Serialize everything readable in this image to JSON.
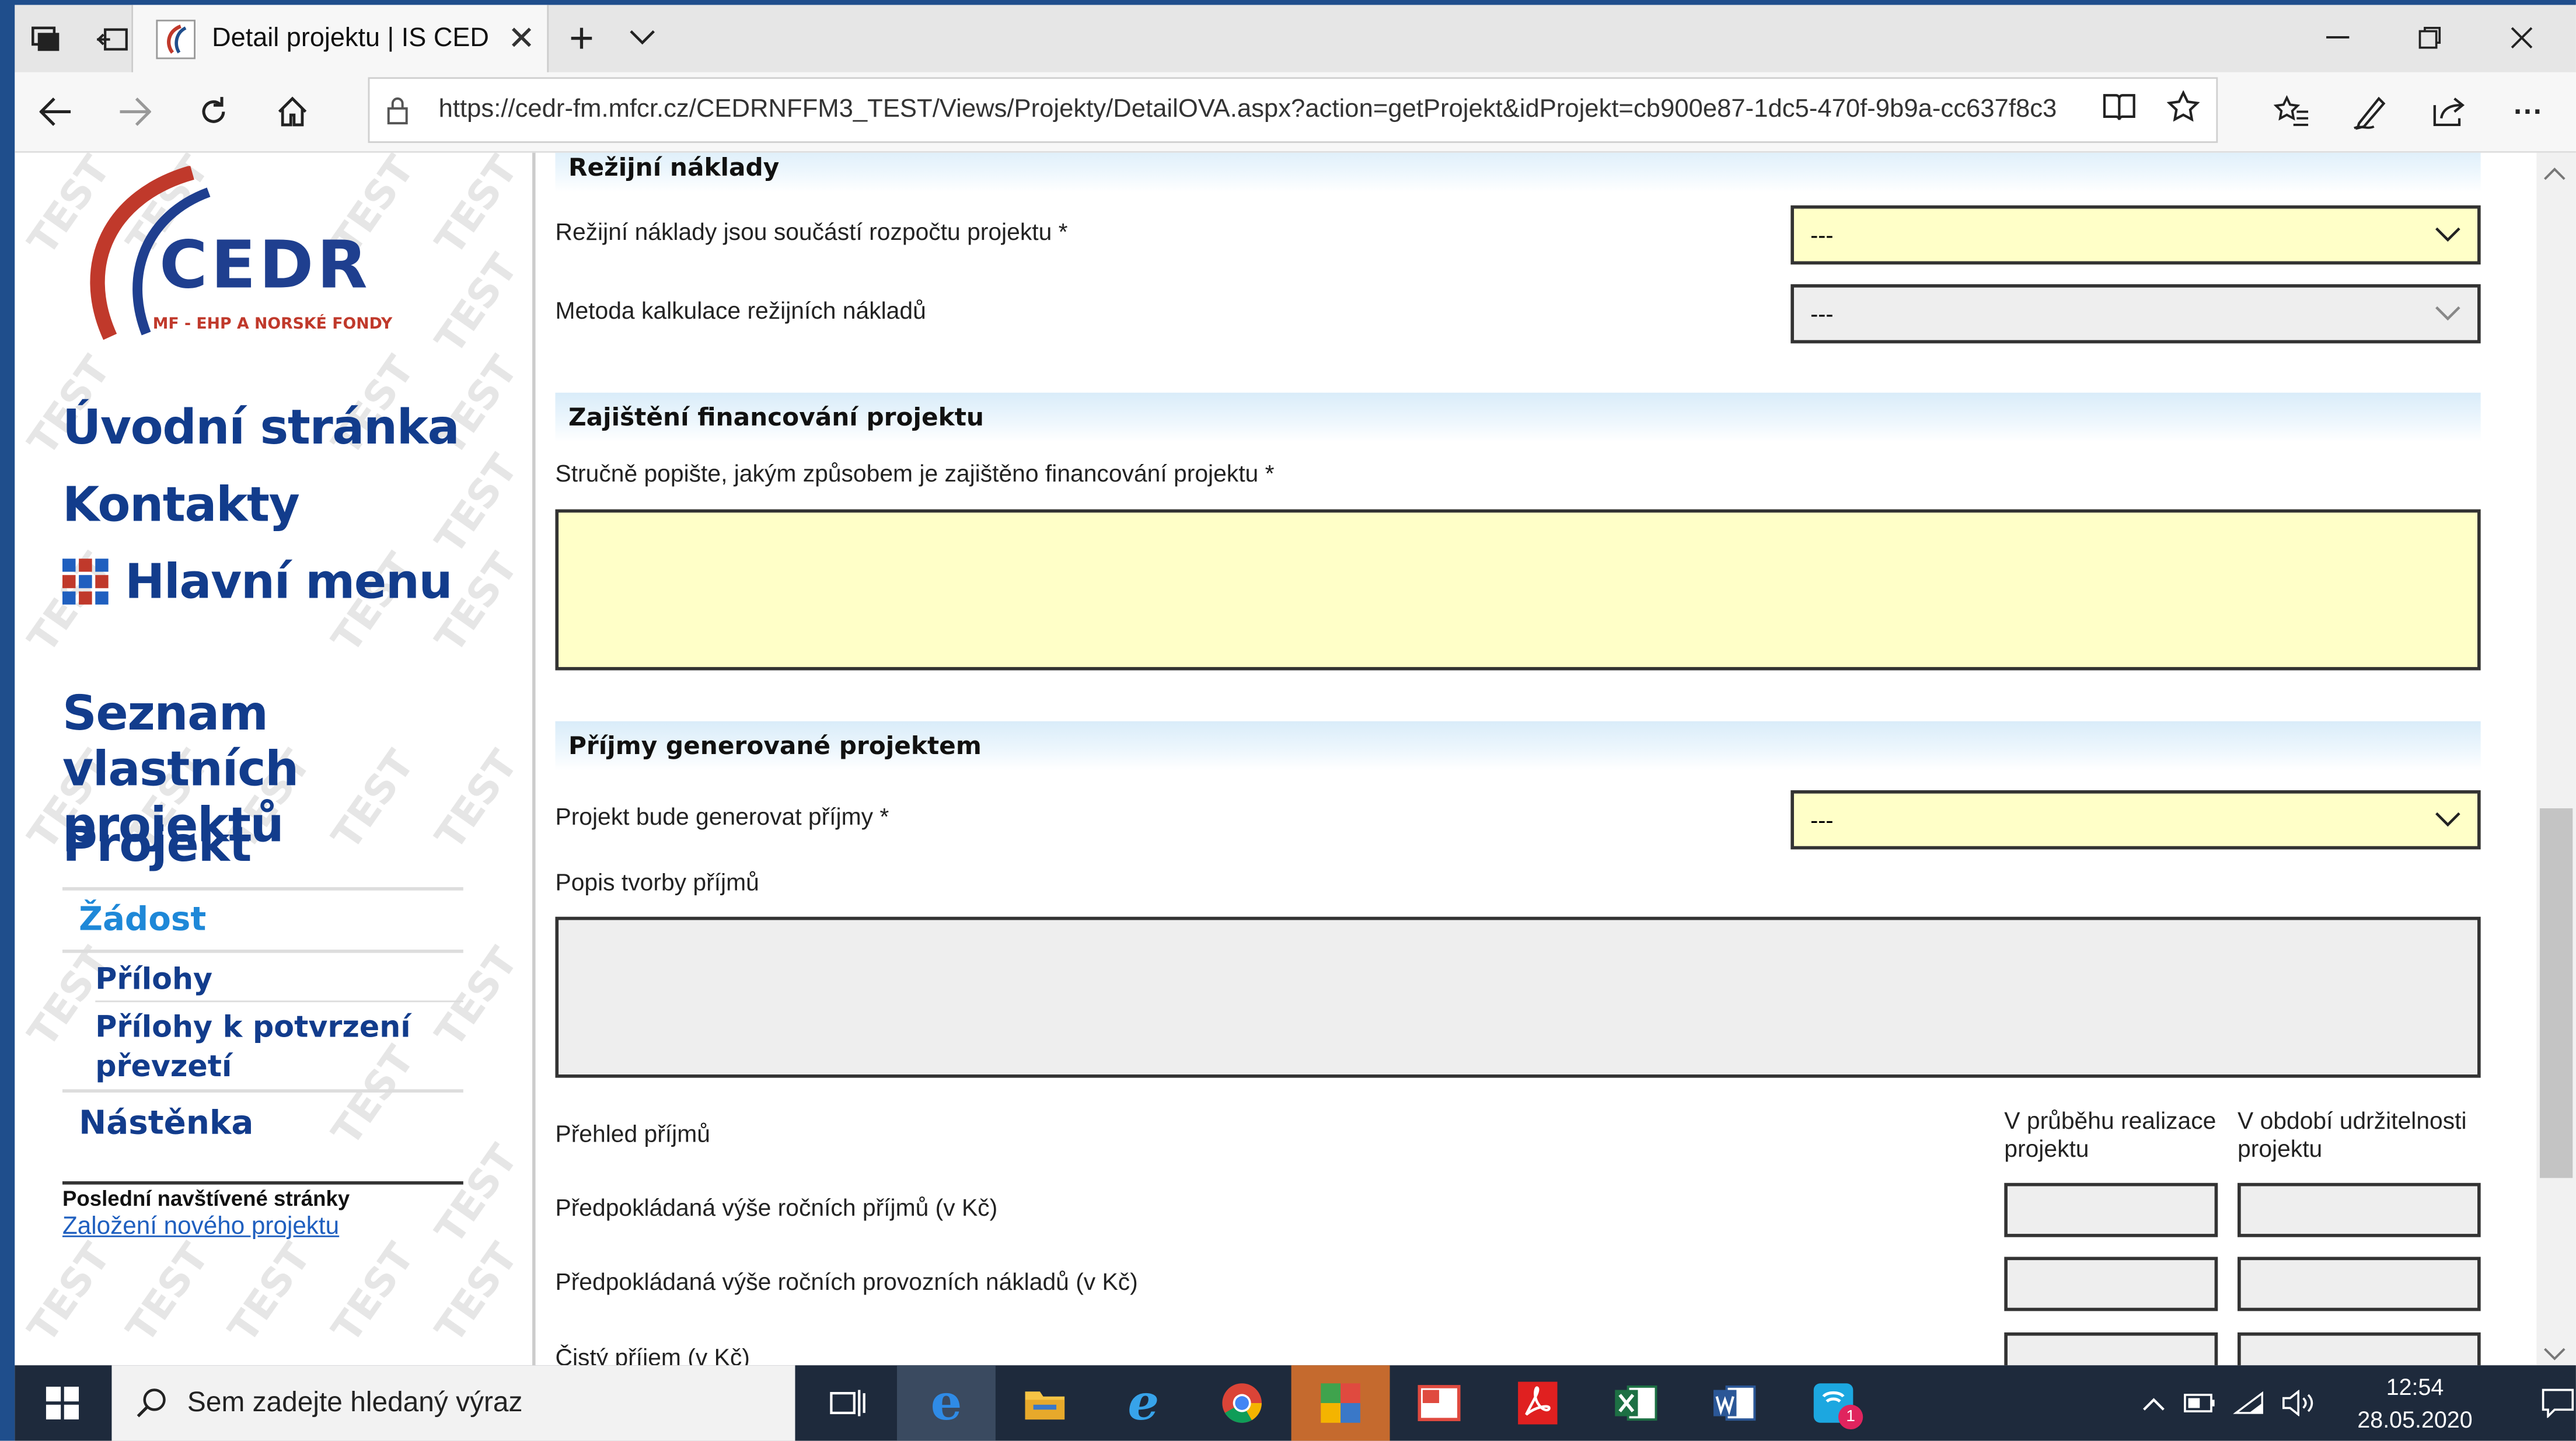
{
  "browser": {
    "tab_title": "Detail projektu | IS CEDI",
    "url": "https://cedr-fm.mfcr.cz/CEDRNFFM3_TEST/Views/Projekty/DetailOVA.aspx?action=getProjekt&idProjekt=cb900e87-1dc5-470f-9b9a-cc637f8c3",
    "new_tab_symbol": "+",
    "more_symbol": "···"
  },
  "sidebar": {
    "logo_text": "CEDR",
    "logo_subtitle": "MF - EHP A NORSKÉ FONDY",
    "watermark": "TEST",
    "nav": {
      "home": "Úvodní stránka",
      "contacts": "Kontakty",
      "main_menu": "Hlavní menu",
      "own_projects": "Seznam vlastních projektů",
      "project": "Projekt",
      "request": "Žádost",
      "attachments": "Přílohy",
      "attachments_confirm_line1": "Přílohy k potvrzení",
      "attachments_confirm_line2": "převzetí",
      "dashboard": "Nástěnka"
    },
    "recent_title": "Poslední navštívené stránky",
    "recent_link": "Založení nového projektu"
  },
  "main": {
    "section_overhead": "Režijní náklady",
    "overhead_in_budget_label": "Režijní náklady jsou součástí rozpočtu projektu *",
    "overhead_in_budget_value": "---",
    "overhead_method_label": "Metoda kalkulace režijních nákladů",
    "overhead_method_value": "---",
    "section_financing": "Zajištění financování projektu",
    "financing_label": "Stručně popište, jakým způsobem je zajištěno financování projektu *",
    "section_income": "Příjmy generované projektem",
    "income_generate_label": "Projekt bude generovat příjmy *",
    "income_generate_value": "---",
    "income_desc_label": "Popis tvorby příjmů",
    "income_overview_label": "Přehled příjmů",
    "col_realization_line1": "V průběhu realizace",
    "col_realization_line2": "projektu",
    "col_sustain_line1": "V období udržitelnosti",
    "col_sustain_line2": "projektu",
    "row_annual_income": "Předpokládaná výše ročních příjmů (v Kč)",
    "row_annual_costs": "Předpokládaná výše ročních provozních nákladů (v Kč)",
    "row_net_income": "Čistý příjem (v Kč)"
  },
  "taskbar": {
    "search_placeholder": "Sem zadejte hledaný výraz",
    "time": "12:54",
    "date": "28.05.2020",
    "notification_badge": "1"
  }
}
